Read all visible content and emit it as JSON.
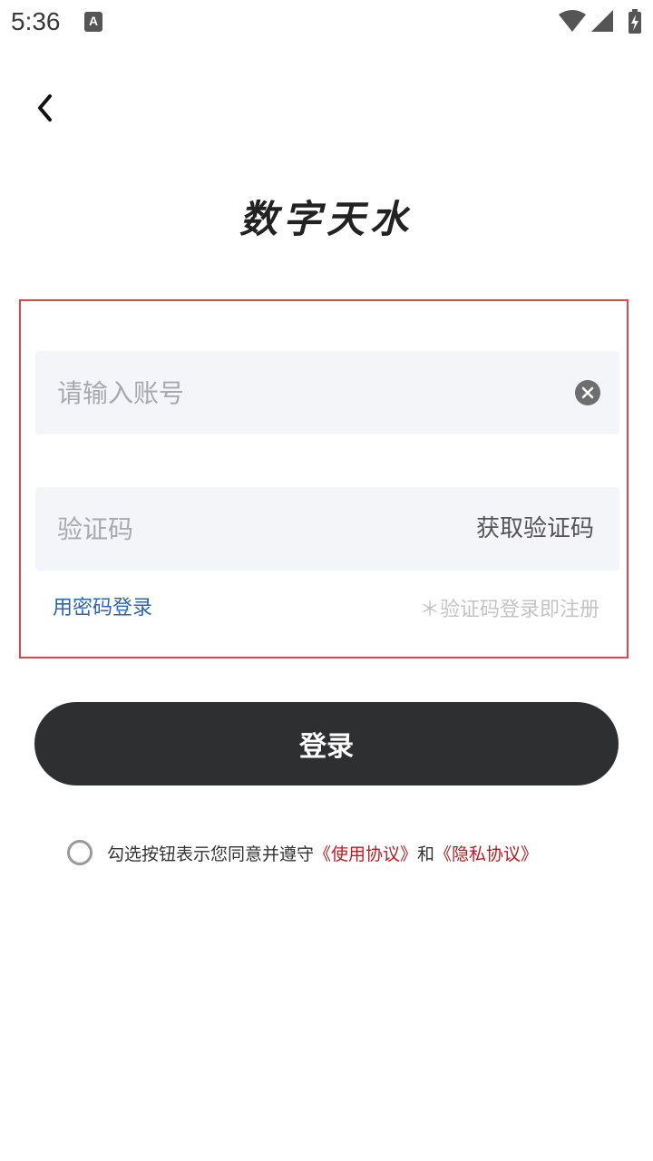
{
  "status_bar": {
    "time": "5:36",
    "notification_icon": "A"
  },
  "header": {
    "back_icon": "chevron-left-icon"
  },
  "logo": {
    "text": "数字天水"
  },
  "form": {
    "account_placeholder": "请输入账号",
    "code_placeholder": "验证码",
    "get_code_label": "获取验证码",
    "password_login_label": "用密码登录",
    "register_hint": "＊验证码登录即注册",
    "highlight_border_color": "#d9484b"
  },
  "login_button": {
    "label": "登录"
  },
  "agreement": {
    "prefix": "勾选按钮表示您同意并遵守",
    "terms_link": "《使用协议》",
    "conjunction": "和",
    "privacy_link": "《隐私协议》",
    "link_color": "#b11f24"
  }
}
